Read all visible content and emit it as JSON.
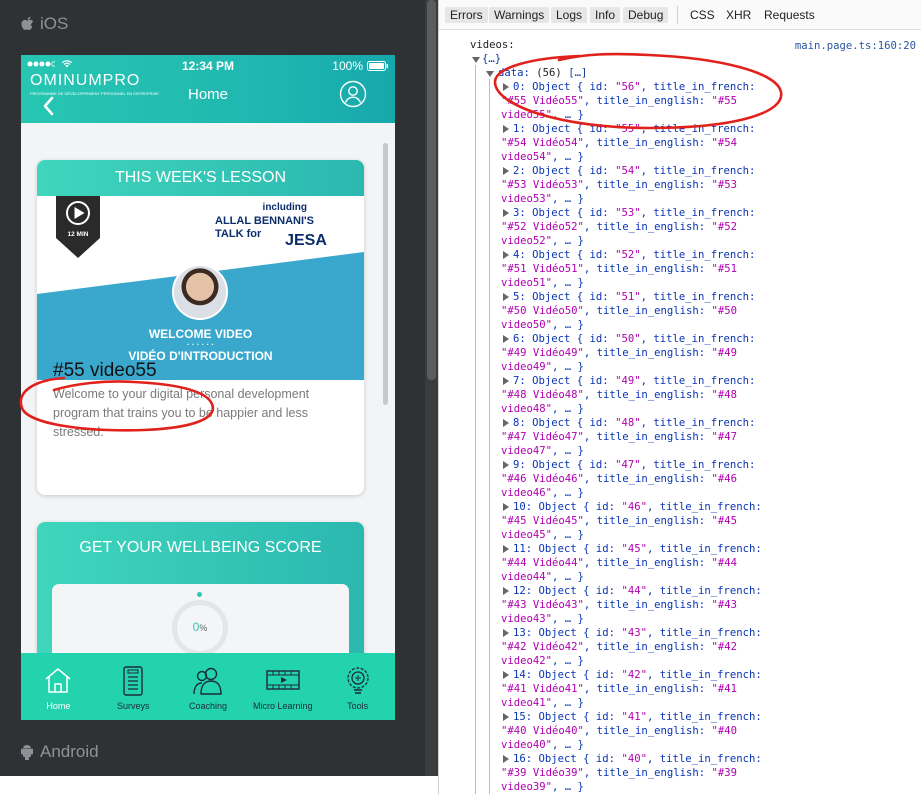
{
  "preview": {
    "ios_label": "iOS",
    "android_label": "Android"
  },
  "app": {
    "status": {
      "time": "12:34 PM",
      "battery": "100%"
    },
    "logo": {
      "name": "OMINUMPRO",
      "tagline": "PROGRAMME DE DÉVELOPPEMENT PERSONNEL EN ENTREPRISE"
    },
    "title": "Home",
    "lesson_card": {
      "header": "THIS WEEK'S LESSON",
      "thumbnail": {
        "duration": "12 MIN",
        "including": "including",
        "speaker": "ALLAL BENNANI'S",
        "talk_for": "TALK for",
        "company": "JESA",
        "welcome_en": "WELCOME VIDEO",
        "dots": "· · · · · ·",
        "welcome_fr": "VIDÉO D'INTRODUCTION"
      },
      "video_title": "#55 video55",
      "description": "Welcome to your digital personal development program that trains you to be happier and less stressed."
    },
    "score_card": {
      "title": "GET YOUR WELLBEING SCORE",
      "value": "0",
      "unit": "%"
    },
    "tabs": [
      {
        "label": "Home",
        "icon": "home-icon"
      },
      {
        "label": "Surveys",
        "icon": "survey-icon"
      },
      {
        "label": "Coaching",
        "icon": "coaching-icon"
      },
      {
        "label": "Micro Learning",
        "icon": "film-icon"
      },
      {
        "label": "Tools",
        "icon": "lightbulb-gear-icon"
      }
    ]
  },
  "devtools": {
    "filters": [
      "Errors",
      "Warnings",
      "Logs",
      "Info",
      "Debug"
    ],
    "types": [
      "CSS",
      "XHR",
      "Requests"
    ],
    "source": "main.page.ts:160:20",
    "log_label": "videos:",
    "open_brace": "{…}",
    "data_label": "data:",
    "data_count": "(56)",
    "data_preview": "[…]",
    "entries": [
      {
        "idx": "0",
        "id": "56",
        "fr": "#55 Vidéo55",
        "en_start": "#55",
        "en_end": "video55\""
      },
      {
        "idx": "1",
        "id": "55",
        "fr": "#54 Vidéo54",
        "en_start": "#54",
        "en_end": "video54\""
      },
      {
        "idx": "2",
        "id": "54",
        "fr": "#53 Vidéo53",
        "en_start": "#53",
        "en_end": "video53\""
      },
      {
        "idx": "3",
        "id": "53",
        "fr": "#52 Vidéo52",
        "en_start": "#52",
        "en_end": "video52\""
      },
      {
        "idx": "4",
        "id": "52",
        "fr": "#51 Vidéo51",
        "en_start": "#51",
        "en_end": "video51\""
      },
      {
        "idx": "5",
        "id": "51",
        "fr": "#50 Vidéo50",
        "en_start": "#50",
        "en_end": "video50\""
      },
      {
        "idx": "6",
        "id": "50",
        "fr": "#49 Vidéo49",
        "en_start": "#49",
        "en_end": "video49\""
      },
      {
        "idx": "7",
        "id": "49",
        "fr": "#48 Vidéo48",
        "en_start": "#48",
        "en_end": "video48\""
      },
      {
        "idx": "8",
        "id": "48",
        "fr": "#47 Vidéo47",
        "en_start": "#47",
        "en_end": "video47\""
      },
      {
        "idx": "9",
        "id": "47",
        "fr": "#46 Vidéo46",
        "en_start": "#46",
        "en_end": "video46\""
      },
      {
        "idx": "10",
        "id": "46",
        "fr": "#45 Vidéo45",
        "en_start": "#45",
        "en_end": "video45\""
      },
      {
        "idx": "11",
        "id": "45",
        "fr": "#44 Vidéo44",
        "en_start": "#44",
        "en_end": "video44\""
      },
      {
        "idx": "12",
        "id": "44",
        "fr": "#43 Vidéo43",
        "en_start": "#43",
        "en_end": "video43\""
      },
      {
        "idx": "13",
        "id": "43",
        "fr": "#42 Vidéo42",
        "en_start": "#42",
        "en_end": "video42\""
      },
      {
        "idx": "14",
        "id": "42",
        "fr": "#41 Vidéo41",
        "en_start": "#41",
        "en_end": "video41\""
      },
      {
        "idx": "15",
        "id": "41",
        "fr": "#40 Vidéo40",
        "en_start": "#40",
        "en_end": "video40\""
      },
      {
        "idx": "16",
        "id": "40",
        "fr": "#39 Vidéo39",
        "en_start": "#39",
        "en_end": "video39\""
      }
    ],
    "colors": {
      "keyword": "#0a34b3",
      "string": "#b000b0",
      "annotation": "#e0211c"
    }
  }
}
